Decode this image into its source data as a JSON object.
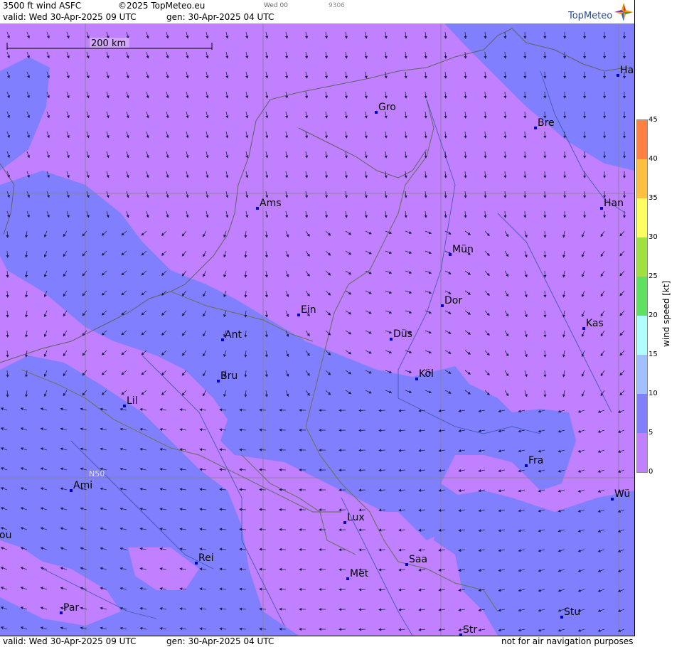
{
  "header": {
    "product": "3500 ft wind ASFC",
    "copyright": "©2025 TopMeteo.eu",
    "run": "Wed 00",
    "code": "9306",
    "valid": "valid:  Wed  30-Apr-2025  09 UTC",
    "gen": "gen: 30-Apr-2025 04 UTC",
    "logo": "TopMeteo"
  },
  "footer": {
    "valid": "valid:  Wed  30-Apr-2025  09 UTC",
    "gen": "gen: 30-Apr-2025 04 UTC",
    "note": "not for air navigation purposes"
  },
  "map": {
    "scale_label": "200 km",
    "lat_label": "N50",
    "cities": [
      {
        "name": "Ha"
      },
      {
        "name": "Gro"
      },
      {
        "name": "Bre"
      },
      {
        "name": "Ams"
      },
      {
        "name": "Han"
      },
      {
        "name": "Mün"
      },
      {
        "name": "Dor"
      },
      {
        "name": "Ein"
      },
      {
        "name": "Kas"
      },
      {
        "name": "Ant"
      },
      {
        "name": "Düs"
      },
      {
        "name": "Köl"
      },
      {
        "name": "Bru"
      },
      {
        "name": "Lil"
      },
      {
        "name": "Fra"
      },
      {
        "name": "Ami"
      },
      {
        "name": "Wü"
      },
      {
        "name": "Lux"
      },
      {
        "name": "ou"
      },
      {
        "name": "Rei"
      },
      {
        "name": "Saa"
      },
      {
        "name": "Met"
      },
      {
        "name": "Par"
      },
      {
        "name": "Stu"
      },
      {
        "name": "Str"
      }
    ]
  },
  "legend": {
    "title": "wind  speed  [kt]",
    "ticks": [
      "45",
      "40",
      "35",
      "30",
      "25",
      "20",
      "15",
      "10",
      "5",
      "0"
    ],
    "colors": [
      "#c080ff",
      "#8080ff",
      "#a0c0ff",
      "#b0ffff",
      "#60e060",
      "#a0e040",
      "#ffff60",
      "#ffc040",
      "#ff8040"
    ]
  }
}
